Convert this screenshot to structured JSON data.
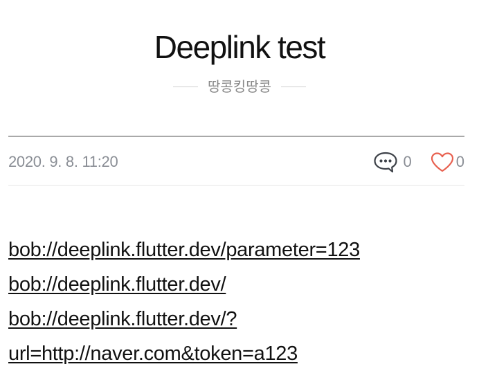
{
  "post": {
    "title": "Deeplink test",
    "author": "땅콩킹땅콩",
    "date": "2020. 9. 8. 11:20",
    "comment_count": "0",
    "like_count": "0"
  },
  "icons": {
    "comments": "speech-bubble-icon",
    "likes": "heart-icon"
  },
  "colors": {
    "heart": "#e8604f",
    "meta_text": "#8a8e95",
    "divider": "#a9a9a9"
  },
  "content": {
    "link1": "bob://deeplink.flutter.dev/parameter=123",
    "link2": "bob://deeplink.flutter.dev/",
    "link3_line1": "bob://deeplink.flutter.dev/?",
    "link3_line2": "url=http://naver.com&token=a123"
  }
}
